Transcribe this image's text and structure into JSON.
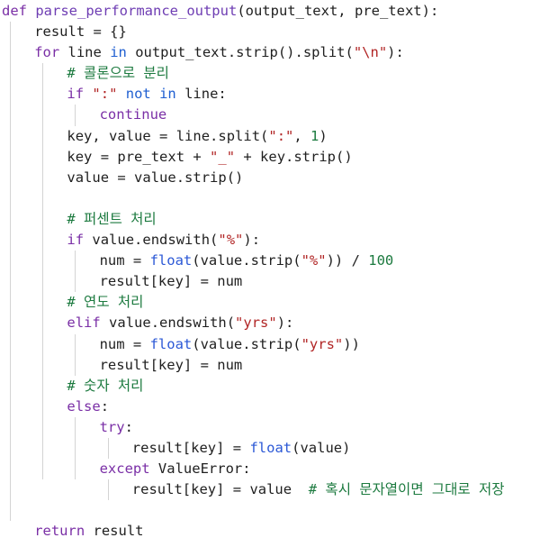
{
  "editor": {
    "language": "python",
    "colors": {
      "keyword": "#7a2fa6",
      "keyword_blue": "#1f5fd1",
      "function_name": "#6e3db3",
      "builtin": "#2b58d6",
      "string": "#b12525",
      "number": "#1c7a3f",
      "comment": "#1c7a3f",
      "plain": "#1f1f1f"
    },
    "lines": [
      {
        "indent": 0,
        "tokens": [
          [
            "kw",
            "def"
          ],
          [
            "pl",
            " "
          ],
          [
            "fn",
            "parse_performance_output"
          ],
          [
            "pl",
            "(output_text, pre_text):"
          ]
        ]
      },
      {
        "indent": 1,
        "tokens": [
          [
            "pl",
            "result = {}"
          ]
        ]
      },
      {
        "indent": 1,
        "tokens": [
          [
            "kw",
            "for"
          ],
          [
            "pl",
            " line "
          ],
          [
            "kb",
            "in"
          ],
          [
            "pl",
            " output_text.strip().split("
          ],
          [
            "str",
            "\"\\n\""
          ],
          [
            "pl",
            "):"
          ]
        ]
      },
      {
        "indent": 2,
        "tokens": [
          [
            "cmt",
            "# 콜론으로 분리"
          ]
        ]
      },
      {
        "indent": 2,
        "tokens": [
          [
            "kw",
            "if"
          ],
          [
            "pl",
            " "
          ],
          [
            "str",
            "\":\""
          ],
          [
            "pl",
            " "
          ],
          [
            "kb",
            "not"
          ],
          [
            "pl",
            " "
          ],
          [
            "kb",
            "in"
          ],
          [
            "pl",
            " line:"
          ]
        ]
      },
      {
        "indent": 3,
        "tokens": [
          [
            "kw",
            "continue"
          ]
        ]
      },
      {
        "indent": 2,
        "tokens": [
          [
            "pl",
            "key, value = line.split("
          ],
          [
            "str",
            "\":\""
          ],
          [
            "pl",
            ", "
          ],
          [
            "num",
            "1"
          ],
          [
            "pl",
            ")"
          ]
        ]
      },
      {
        "indent": 2,
        "tokens": [
          [
            "pl",
            "key = pre_text + "
          ],
          [
            "str",
            "\"_\""
          ],
          [
            "pl",
            " + key.strip()"
          ]
        ]
      },
      {
        "indent": 2,
        "tokens": [
          [
            "pl",
            "value = value.strip()"
          ]
        ]
      },
      {
        "indent": 2,
        "tokens": []
      },
      {
        "indent": 2,
        "tokens": [
          [
            "cmt",
            "# 퍼센트 처리"
          ]
        ]
      },
      {
        "indent": 2,
        "tokens": [
          [
            "kw",
            "if"
          ],
          [
            "pl",
            " value.endswith("
          ],
          [
            "str",
            "\"%\""
          ],
          [
            "pl",
            "):"
          ]
        ]
      },
      {
        "indent": 3,
        "tokens": [
          [
            "pl",
            "num = "
          ],
          [
            "bi",
            "float"
          ],
          [
            "pl",
            "(value.strip("
          ],
          [
            "str",
            "\"%\""
          ],
          [
            "pl",
            ")) / "
          ],
          [
            "num",
            "100"
          ]
        ]
      },
      {
        "indent": 3,
        "tokens": [
          [
            "pl",
            "result[key] = num"
          ]
        ]
      },
      {
        "indent": 2,
        "tokens": [
          [
            "cmt",
            "# 연도 처리"
          ]
        ]
      },
      {
        "indent": 2,
        "tokens": [
          [
            "kw",
            "elif"
          ],
          [
            "pl",
            " value.endswith("
          ],
          [
            "str",
            "\"yrs\""
          ],
          [
            "pl",
            "):"
          ]
        ]
      },
      {
        "indent": 3,
        "tokens": [
          [
            "pl",
            "num = "
          ],
          [
            "bi",
            "float"
          ],
          [
            "pl",
            "(value.strip("
          ],
          [
            "str",
            "\"yrs\""
          ],
          [
            "pl",
            "))"
          ]
        ]
      },
      {
        "indent": 3,
        "tokens": [
          [
            "pl",
            "result[key] = num"
          ]
        ]
      },
      {
        "indent": 2,
        "tokens": [
          [
            "cmt",
            "# 숫자 처리"
          ]
        ]
      },
      {
        "indent": 2,
        "tokens": [
          [
            "kw",
            "else"
          ],
          [
            "pl",
            ":"
          ]
        ]
      },
      {
        "indent": 3,
        "tokens": [
          [
            "kw",
            "try"
          ],
          [
            "pl",
            ":"
          ]
        ]
      },
      {
        "indent": 4,
        "tokens": [
          [
            "pl",
            "result[key] = "
          ],
          [
            "bi",
            "float"
          ],
          [
            "pl",
            "(value)"
          ]
        ]
      },
      {
        "indent": 3,
        "tokens": [
          [
            "kw",
            "except"
          ],
          [
            "pl",
            " ValueError:"
          ]
        ]
      },
      {
        "indent": 4,
        "tokens": [
          [
            "pl",
            "result[key] = value  "
          ],
          [
            "cmt",
            "# 혹시 문자열이면 그대로 저장"
          ]
        ]
      },
      {
        "indent": 1,
        "tokens": []
      },
      {
        "indent": 1,
        "tokens": [
          [
            "kw",
            "return"
          ],
          [
            "pl",
            " result"
          ]
        ]
      }
    ],
    "guides": [
      {
        "rows": [
          1,
          24
        ],
        "level": 0
      },
      {
        "rows": [
          3,
          22
        ],
        "level": 1
      },
      {
        "rows": [
          5,
          5
        ],
        "level": 2
      },
      {
        "rows": [
          12,
          13
        ],
        "level": 2
      },
      {
        "rows": [
          16,
          17
        ],
        "level": 2
      },
      {
        "rows": [
          20,
          22
        ],
        "level": 2
      },
      {
        "rows": [
          21,
          21
        ],
        "level": 3
      },
      {
        "rows": [
          23,
          23
        ],
        "level": 3
      }
    ]
  }
}
